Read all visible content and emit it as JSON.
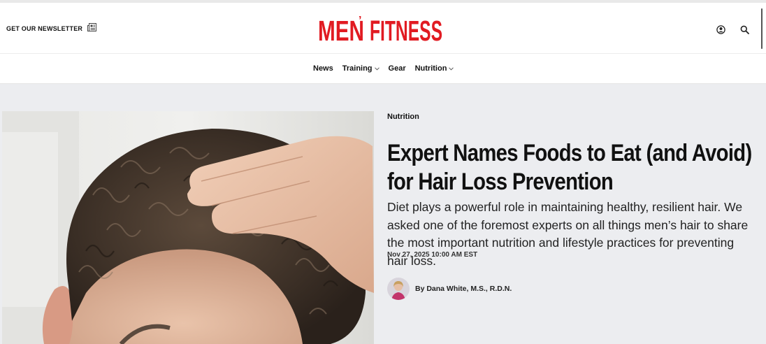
{
  "header": {
    "newsletter_label": "GET OUR NEWSLETTER",
    "logo_text_left": "MEN",
    "logo_text_right": "FITNESS",
    "brand_color": "#e11b22"
  },
  "nav": {
    "items": [
      {
        "label": "News",
        "dropdown": false
      },
      {
        "label": "Training",
        "dropdown": true
      },
      {
        "label": "Gear",
        "dropdown": false
      },
      {
        "label": "Nutrition",
        "dropdown": true
      }
    ]
  },
  "article": {
    "category": "Nutrition",
    "headline_line1": "Expert Names Foods to Eat (and Avoid)",
    "headline_line2": "for Hair Loss Prevention",
    "dek": "Diet plays a powerful role in maintaining healthy, resilient hair. We asked one of the foremost experts on all things men’s hair to share the most important nutrition and lifestyle practices for preventing hair loss.",
    "date": "Nov 27, 2025 10:00 AM EST",
    "byline": "By Dana White, M.S., R.D.N."
  },
  "icons": {
    "newsletter": "newsletter-icon",
    "account": "user-icon",
    "search": "search-icon",
    "dropdown": "chevron-down-icon"
  }
}
